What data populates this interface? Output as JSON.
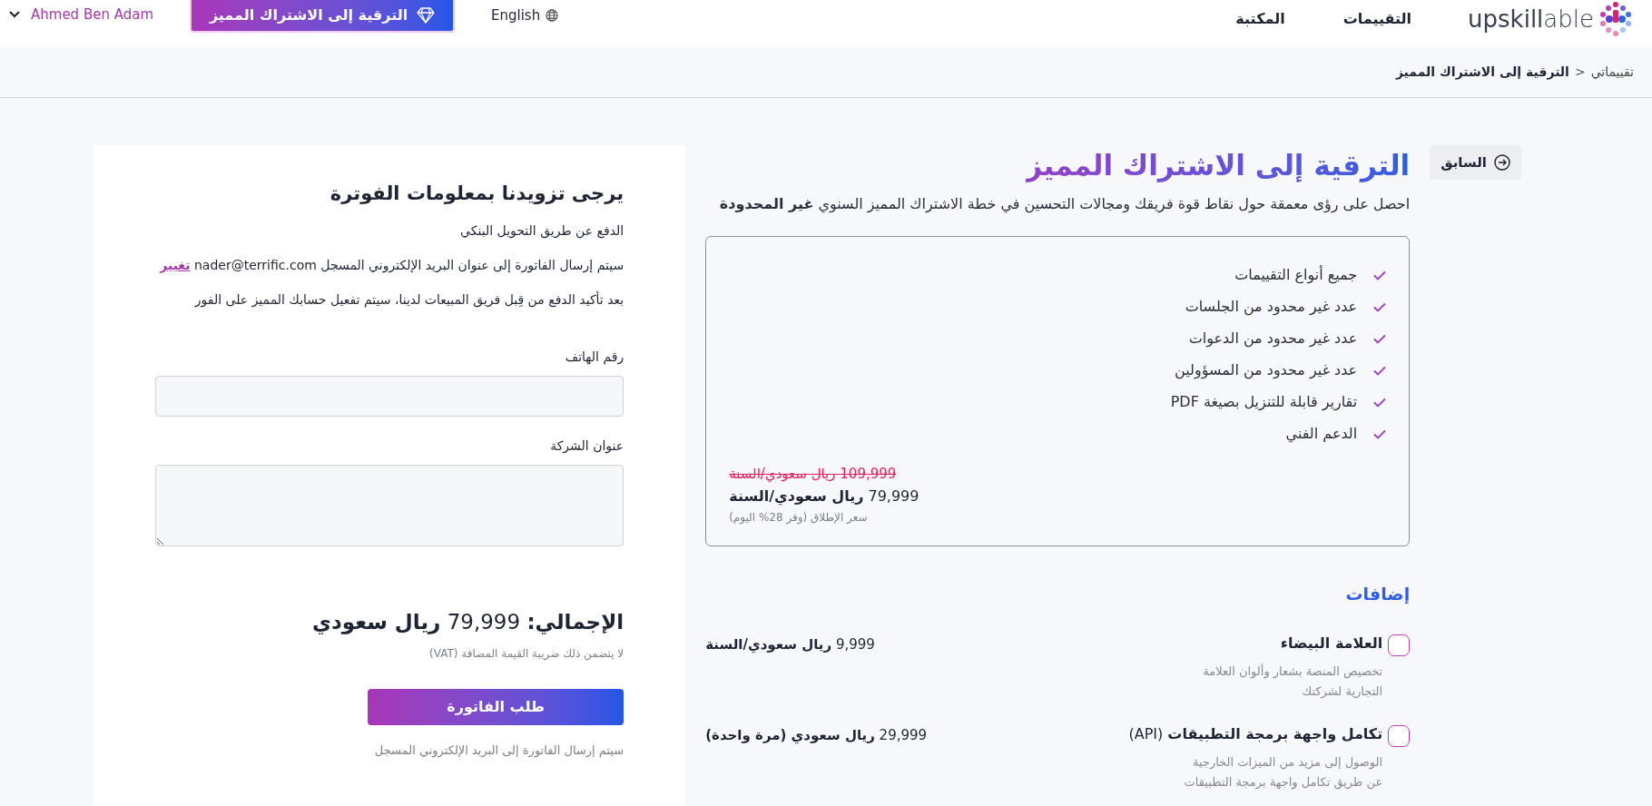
{
  "header": {
    "logo": "**upskill**able",
    "nav": [
      "التقييمات",
      "المكتبة"
    ],
    "language": "English",
    "upgrade_button": "الترقية إلى الاشتراك المميز",
    "user": "Ahmed Ben Adam"
  },
  "breadcrumb": {
    "separator": ">",
    "items": [
      {
        "label": "تقييماتي",
        "current": false
      },
      {
        "label": "الترقية إلى الاشتراك المميز",
        "current": true
      }
    ]
  },
  "back_button": "السابق",
  "plan": {
    "title": "الترقية إلى الاشتراك المميز",
    "description": "احصل على رؤى معمقة حول نقاط قوة فريقك ومجالات التحسين في خطة الاشتراك المميز السنوي **غير المحدودة**",
    "features": [
      "جميع أنواع التقييمات",
      "عدد غير محدود من الجلسات",
      "عدد غير محدود من الدعوات",
      "عدد غير محدود من المسؤولين",
      "تقارير قابلة للتنزيل بصيغة PDF",
      "الدعم الفني"
    ],
    "old_price": "109,999 ريال سعودي/السنة",
    "price": "79,999 **ريال سعودي/السنة**",
    "price_note": "سعر الإطلاق (وفر 28% اليوم)"
  },
  "addons": {
    "title": "إضافات",
    "items": [
      {
        "title": "**العلامة البيضاء**",
        "description": "تخصيص المنصة بشعار وألوان العلامة التجارية لشركتك",
        "price": "9,999 **ريال سعودي/السنة**",
        "checked": false
      },
      {
        "title": "**تكامل واجهة برمجة التطبيقات** (API)",
        "description": "الوصول إلى مزيد من الميزات الخارجية عن طريق تكامل واجهة برمجة التطبيقات",
        "price": "29,999 **ريال سعودي (مرة واحدة)**",
        "checked": false
      }
    ]
  },
  "billing": {
    "title": "يرجى تزويدنا بمعلومات الفوترة",
    "payment_method": "الدفع عن طريق التحويل البنكي",
    "email_notice": "سيتم إرسال الفاتورة إلى عنوان البريد الإلكتروني المسجل nader@terrific.com",
    "change_link": "تغيير",
    "activation_notice": "بعد تأكيد الدفع من قِبل فريق المبيعات لدينا، سيتم تفعيل حسابك المميز على الفور",
    "fields": [
      {
        "label": "رقم الهاتف",
        "kind": "input"
      },
      {
        "label": "عنوان الشركة",
        "kind": "textarea"
      }
    ],
    "total": "**الإجمالي:** 79,999 **ريال سعودي**",
    "vat_note": "لا يتضمن ذلك ضريبة القيمة المضافة (VAT)",
    "submit_button": "طلب الفاتورة",
    "footer_note": "سيتم إرسال الفاتورة إلى البريد الإلكتروني المسجل"
  }
}
